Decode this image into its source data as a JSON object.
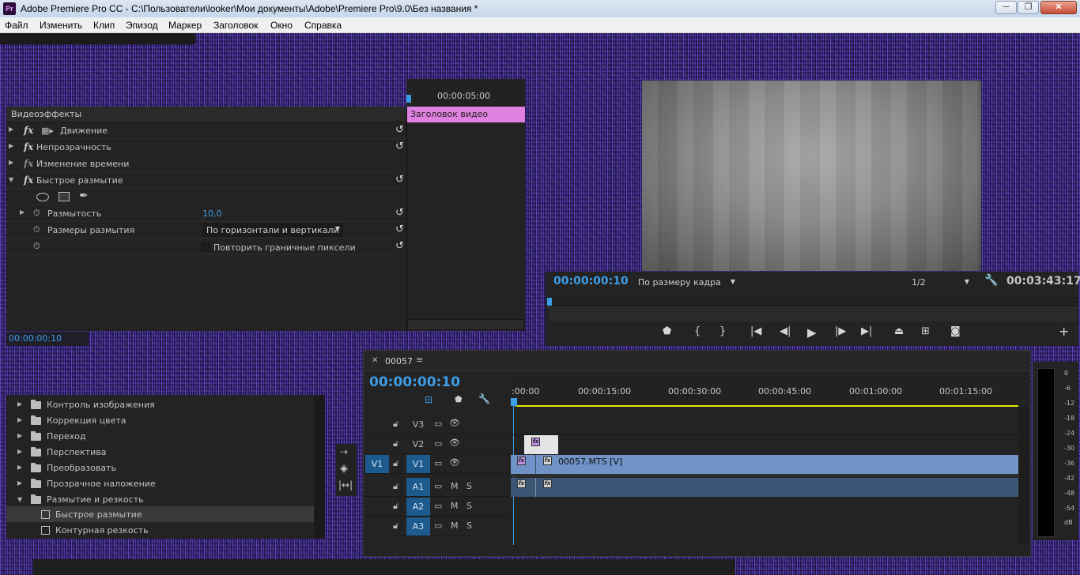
{
  "window": {
    "app_icon": "Pr",
    "title": "Adobe Premiere Pro CC - C:\\Пользователи\\looker\\Мои документы\\Adobe\\Premiere Pro\\9.0\\Без названия *",
    "min": "─",
    "max": "❐",
    "close": "✕"
  },
  "menu": [
    "Файл",
    "Изменить",
    "Клип",
    "Эпизод",
    "Маркер",
    "Заголовок",
    "Окно",
    "Справка"
  ],
  "effect_controls": {
    "header": "Видеоэффекты",
    "rows": [
      {
        "label": "Движение",
        "fx": "fx"
      },
      {
        "label": "Непрозрачность",
        "fx": "fx"
      },
      {
        "label": "Изменение времени",
        "fx": "fx"
      },
      {
        "label": "Быстрое размытие",
        "fx": "fx"
      }
    ],
    "blurriness_label": "Размытость",
    "blurriness_value": "10,0",
    "dimensions_label": "Размеры размытия",
    "dimensions_value": "По горизонтали и вертикали",
    "repeat_edge_label": "Повторить граничные пиксели",
    "mini_timeline_tc": "00:00:05:00",
    "clip_label": "Заголовок видео",
    "current_tc": "00:00:00:10"
  },
  "program": {
    "timecode": "00:00:00:10",
    "fit": "По размеру кадра",
    "resolution": "1/2",
    "duration": "00:03:43:17",
    "buttons": [
      "marker-icon",
      "mark-in-icon",
      "mark-out-icon",
      "go-to-in-icon",
      "step-back-icon",
      "play-icon",
      "step-forward-icon",
      "go-to-out-icon",
      "lift-icon",
      "extract-icon",
      "export-frame-icon",
      "add-button-icon"
    ]
  },
  "effects_browser": {
    "folders": [
      "Контроль изображения",
      "Коррекция цвета",
      "Переход",
      "Перспектива",
      "Преобразовать",
      "Прозрачное наложение",
      "Размытие и резкость"
    ],
    "items": [
      "Быстрое размытие",
      "Контурная резкость"
    ]
  },
  "timeline": {
    "sequence": "00057",
    "timecode": "00:00:00:10",
    "ticks": [
      ":00:00",
      "00:00:15:00",
      "00:00:30:00",
      "00:00:45:00",
      "00:01:00:00",
      "00:01:15:00"
    ],
    "video_tracks": [
      "V3",
      "V2",
      "V1"
    ],
    "source_patch": "V1",
    "audio_tracks": [
      "A1",
      "A2",
      "A3"
    ],
    "mute": "M",
    "solo": "S",
    "clip_name": "00057.MTS [V]"
  },
  "audio_meter": {
    "scale": [
      "0",
      "-6",
      "-12",
      "-18",
      "-24",
      "-30",
      "-36",
      "-42",
      "-48",
      "-54",
      "dB"
    ]
  },
  "colors": {
    "accent_blue": "#3d9de6",
    "title_clip": "#e080e0",
    "video_clip": "#6f93c7",
    "audio_clip": "#3d5574"
  }
}
